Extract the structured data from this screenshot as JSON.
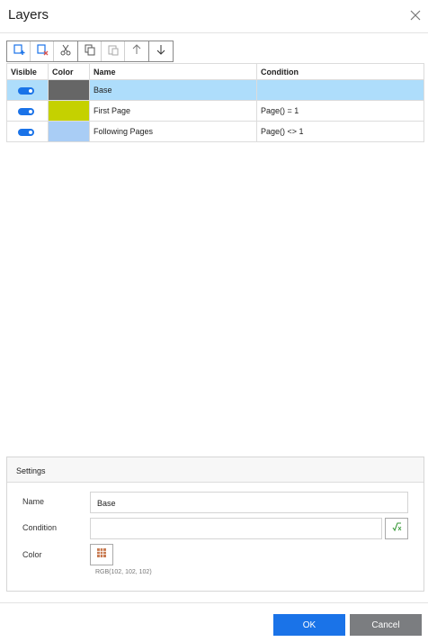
{
  "dialog": {
    "title": "Layers",
    "close_icon": "close-icon"
  },
  "toolbar": {
    "buttons": [
      {
        "name": "add-layer",
        "icon": "add-layer-icon"
      },
      {
        "name": "remove-layer",
        "icon": "remove-layer-icon"
      },
      {
        "name": "cut",
        "icon": "scissors-icon"
      },
      {
        "name": "copy",
        "icon": "copy-icon"
      },
      {
        "name": "paste",
        "icon": "paste-icon"
      },
      {
        "name": "move-up",
        "icon": "arrow-up-icon"
      },
      {
        "name": "move-down",
        "icon": "arrow-down-icon"
      }
    ]
  },
  "grid": {
    "headers": {
      "visible": "Visible",
      "color": "Color",
      "name": "Name",
      "condition": "Condition"
    },
    "rows": [
      {
        "visible": true,
        "color": "#666666",
        "name": "Base",
        "condition": "",
        "selected": true
      },
      {
        "visible": true,
        "color": "#c5d100",
        "name": "First Page",
        "condition": "Page() = 1",
        "selected": false
      },
      {
        "visible": true,
        "color": "#a9cdf5",
        "name": "Following Pages",
        "condition": "Page() <> 1",
        "selected": false
      }
    ]
  },
  "settings": {
    "title": "Settings",
    "name_label": "Name",
    "name_value": "Base",
    "condition_label": "Condition",
    "condition_value": "",
    "color_label": "Color",
    "color_value_text": "RGB(102, 102, 102)"
  },
  "footer": {
    "ok_label": "OK",
    "cancel_label": "Cancel"
  },
  "colors": {
    "accent": "#1a73e8",
    "selected_row": "#aeddfb",
    "cancel": "#7b7d80"
  }
}
